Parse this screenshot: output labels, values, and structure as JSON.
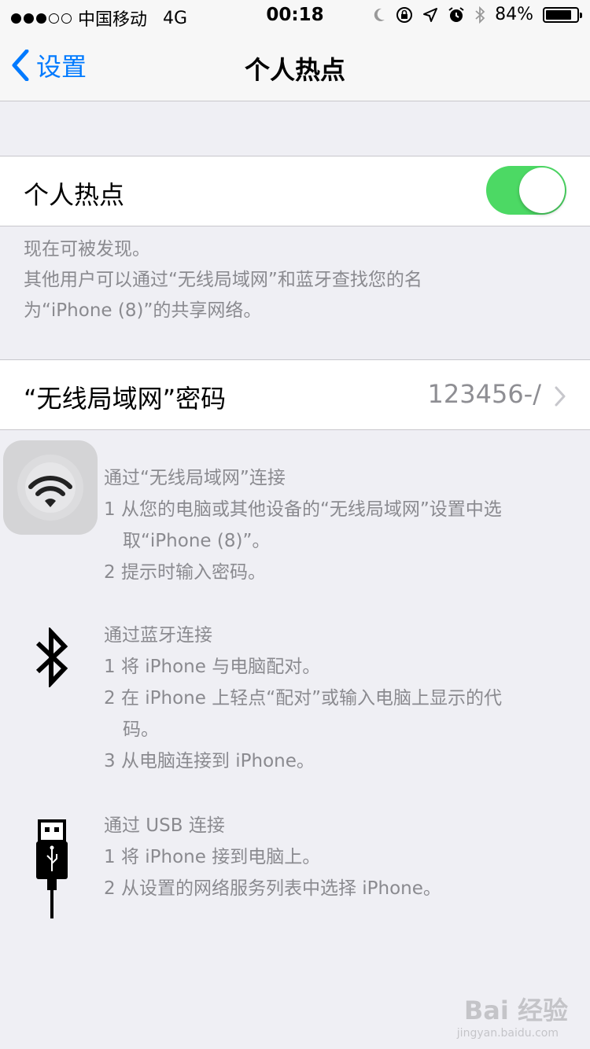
{
  "status_bar": {
    "carrier": "中国移动",
    "network": "4G",
    "time": "00:18",
    "battery": "84%",
    "battery_level": 0.84
  },
  "nav": {
    "back_label": "设置",
    "title": "个人热点"
  },
  "hotspot": {
    "label": "个人热点",
    "enabled": true,
    "footer_lines": [
      "现在可被发现。",
      "其他用户可以通过“无线局域网”和蓝牙查找您的名",
      "为“iPhone (8)”的共享网络。"
    ]
  },
  "wifi_password": {
    "label": "“无线局域网”密码",
    "value": "123456-/"
  },
  "instructions": {
    "wifi": {
      "icon": "wifi-icon",
      "title": "通过“无线局域网”连接",
      "lines": [
        "1 从您的电脑或其他设备的“无线局域网”设置中选",
        "取“iPhone (8)”。",
        "2 提示时输入密码。"
      ]
    },
    "bluetooth": {
      "icon": "bluetooth-icon",
      "title": "通过蓝牙连接",
      "lines": [
        "1 将 iPhone 与电脑配对。",
        "2 在 iPhone 上轻点“配对”或输入电脑上显示的代",
        "码。",
        "3 从电脑连接到 iPhone。"
      ]
    },
    "usb": {
      "icon": "usb-icon",
      "title": "通过 USB 连接",
      "lines": [
        "1 将 iPhone 接到电脑上。",
        "2 从设置的网络服务列表中选择 iPhone。"
      ]
    }
  },
  "watermark": {
    "text": "Bai 经验",
    "sub": "jingyan.baidu.com"
  },
  "colors": {
    "accent": "#007aff",
    "toggle_on": "#4cd964",
    "background": "#efeff4",
    "secondary_text": "#8a8a8f"
  }
}
